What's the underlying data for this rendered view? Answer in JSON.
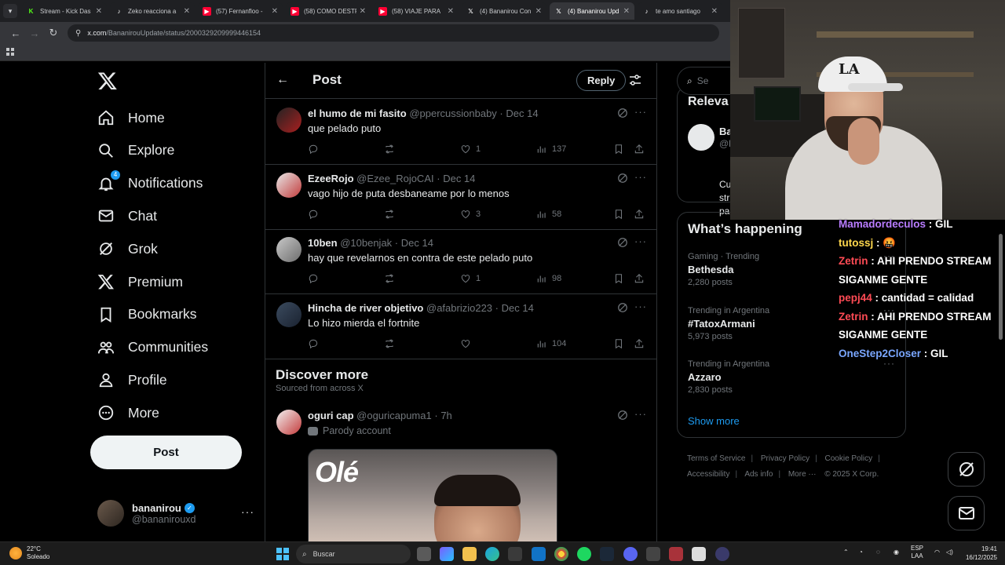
{
  "browser": {
    "tabs": [
      {
        "title": "Stream - Kick Das",
        "favicon": "kick-icon",
        "color": "#53fc18",
        "active": false
      },
      {
        "title": "Zeko reacciona a",
        "favicon": "tiktok-icon",
        "color": "#ffffff",
        "active": false
      },
      {
        "title": "(57) Fernanfloo -",
        "favicon": "youtube-icon",
        "color": "#ff0033",
        "active": false
      },
      {
        "title": "(58) COMO DESTR",
        "favicon": "youtube-icon",
        "color": "#ff0033",
        "active": false
      },
      {
        "title": "(58) VIAJE PARA",
        "favicon": "youtube-icon",
        "color": "#ff0033",
        "active": false
      },
      {
        "title": "(4) Bananirou Con",
        "favicon": "x-icon",
        "color": "#ffffff",
        "active": false
      },
      {
        "title": "(4) Bananirou Upd",
        "favicon": "x-icon",
        "color": "#ffffff",
        "active": true
      },
      {
        "title": "te amo santiago",
        "favicon": "tiktok-icon",
        "color": "#ffffff",
        "active": false
      }
    ],
    "url_host": "x.com",
    "url_path": "/BananirouUpdate/status/2000329209999446154"
  },
  "nav": {
    "items": [
      {
        "label": "Home",
        "icon": "home-icon"
      },
      {
        "label": "Explore",
        "icon": "search-icon"
      },
      {
        "label": "Notifications",
        "icon": "bell-icon",
        "badge": "4"
      },
      {
        "label": "Chat",
        "icon": "mail-icon"
      },
      {
        "label": "Grok",
        "icon": "grok-icon"
      },
      {
        "label": "Premium",
        "icon": "x-logo-icon"
      },
      {
        "label": "Bookmarks",
        "icon": "bookmark-icon"
      },
      {
        "label": "Communities",
        "icon": "communities-icon"
      },
      {
        "label": "Profile",
        "icon": "profile-icon"
      },
      {
        "label": "More",
        "icon": "more-circle-icon"
      }
    ],
    "post_label": "Post",
    "account": {
      "name": "bananirou",
      "handle": "@bananirouxd"
    }
  },
  "post_header": {
    "title": "Post",
    "reply_label": "Reply"
  },
  "replies": [
    {
      "name": "el humo de mi fasito",
      "handle": "@ppercussionbaby",
      "date": "Dec 14",
      "text": "que pelado puto",
      "likes": "1",
      "views": "137"
    },
    {
      "name": "EzeeRojo",
      "handle": "@Ezee_RojoCAI",
      "date": "Dec 14",
      "text": "vago hijo de puta desbaneame por lo menos",
      "likes": "3",
      "views": "58"
    },
    {
      "name": "10ben",
      "handle": "@10benjak",
      "date": "Dec 14",
      "text": "hay que revelarnos en contra de este pelado puto",
      "likes": "1",
      "views": "98"
    },
    {
      "name": "Hincha de river objetivo",
      "handle": "@afabrizio223",
      "date": "Dec 14",
      "text": "Lo hizo mierda el fortnite",
      "likes": "",
      "views": "104"
    }
  ],
  "discover": {
    "title": "Discover more",
    "subtitle": "Sourced from across X",
    "post": {
      "name": "oguri cap",
      "handle": "@oguricapuma1",
      "time": "7h",
      "label": "Parody account",
      "media_text": "Olé"
    }
  },
  "sidebar": {
    "search_placeholder": "Se",
    "relevant_title": "Releva",
    "relevant_name": "Ba",
    "relevant_handle": "@b",
    "relevant_bio_lines": [
      "Cu",
      "str",
      "pa"
    ],
    "happening_title": "What’s happening",
    "trends": [
      {
        "context": "Gaming · Trending",
        "name": "Bethesda",
        "count": "2,280 posts"
      },
      {
        "context": "Trending in Argentina",
        "name": "#TatoxArmani",
        "count": "5,973 posts"
      },
      {
        "context": "Trending in Argentina",
        "name": "Azzaro",
        "count": "2,830 posts"
      }
    ],
    "show_more": "Show more",
    "footer": {
      "terms": "Terms of Service",
      "privacy": "Privacy Policy",
      "cookie": "Cookie Policy",
      "accessibility": "Accessibility",
      "ads": "Ads info",
      "more": "More ···",
      "copyright": "© 2025 X Corp."
    }
  },
  "stream_chat": [
    {
      "user": "Mamadordeculos",
      "color": "#b87cff",
      "msg": " : GIL"
    },
    {
      "user": "tutossj",
      "color": "#ffd84d",
      "msg": " : 🤬"
    },
    {
      "user": "Zetrin",
      "color": "#ff4b55",
      "msg": " : AHI PRENDO STREAM"
    },
    {
      "user": "",
      "color": "#ffffff",
      "msg": "SIGANME GENTE"
    },
    {
      "user": "pepj44",
      "color": "#ff4b55",
      "msg": " : cantidad = calidad"
    },
    {
      "user": "Zetrin",
      "color": "#ff4b55",
      "msg": " : AHI PRENDO STREAM"
    },
    {
      "user": "",
      "color": "#ffffff",
      "msg": "SIGANME GENTE"
    },
    {
      "user": "OneStep2Closer",
      "color": "#7aa7ff",
      "msg": " : GIL"
    }
  ],
  "taskbar": {
    "weather_temp": "22°C",
    "weather_desc": "Soleado",
    "search_label": "Buscar",
    "lang_top": "ESP",
    "lang_bottom": "LAA",
    "time": "19:41",
    "date": "16/12/2025"
  },
  "colors": {
    "accent": "#1d9bf0",
    "bg": "#000000",
    "border": "#2f3336",
    "muted": "#71767b"
  }
}
